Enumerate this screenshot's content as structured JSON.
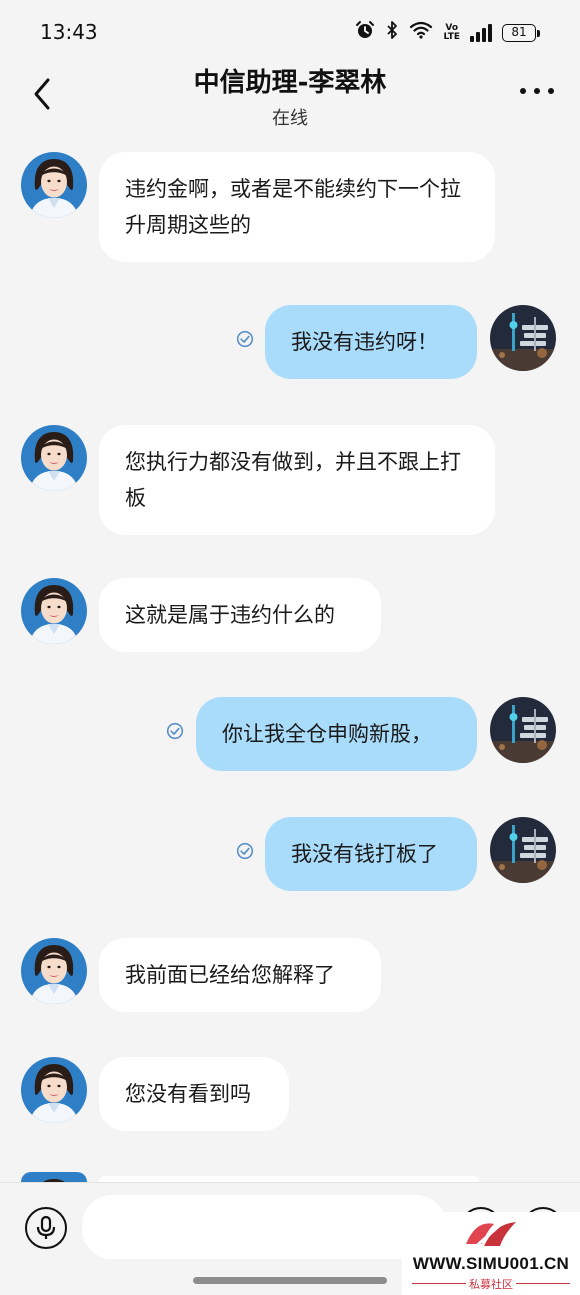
{
  "status_bar": {
    "time": "13:43",
    "volte": "Vo\nLTE",
    "battery": "81"
  },
  "header": {
    "title": "中信助理-李翠林",
    "subtitle": "在线"
  },
  "messages": [
    {
      "side": "in",
      "text": "违约金啊，或者是不能续约下一个拉升周期这些的"
    },
    {
      "side": "out",
      "text": "我没有违约呀！"
    },
    {
      "side": "in",
      "text": "您执行力都没有做到，并且不跟上打板"
    },
    {
      "side": "in",
      "text": "这就是属于违约什么的"
    },
    {
      "side": "out",
      "text": "你让我全仓申购新股，"
    },
    {
      "side": "out",
      "text": "我没有钱打板了"
    },
    {
      "side": "in",
      "text": "我前面已经给您解释了"
    },
    {
      "side": "in",
      "text": "您没有看到吗"
    }
  ],
  "input": {
    "value": "",
    "placeholder": ""
  },
  "watermark": {
    "site": "WWW.SIMU001.CN",
    "sub": "私募社区"
  },
  "colors": {
    "outgoing_bubble": "#a9dcfb",
    "incoming_bubble": "#ffffff",
    "background": "#f4f4f4",
    "read_check": "#5a8fc8"
  }
}
